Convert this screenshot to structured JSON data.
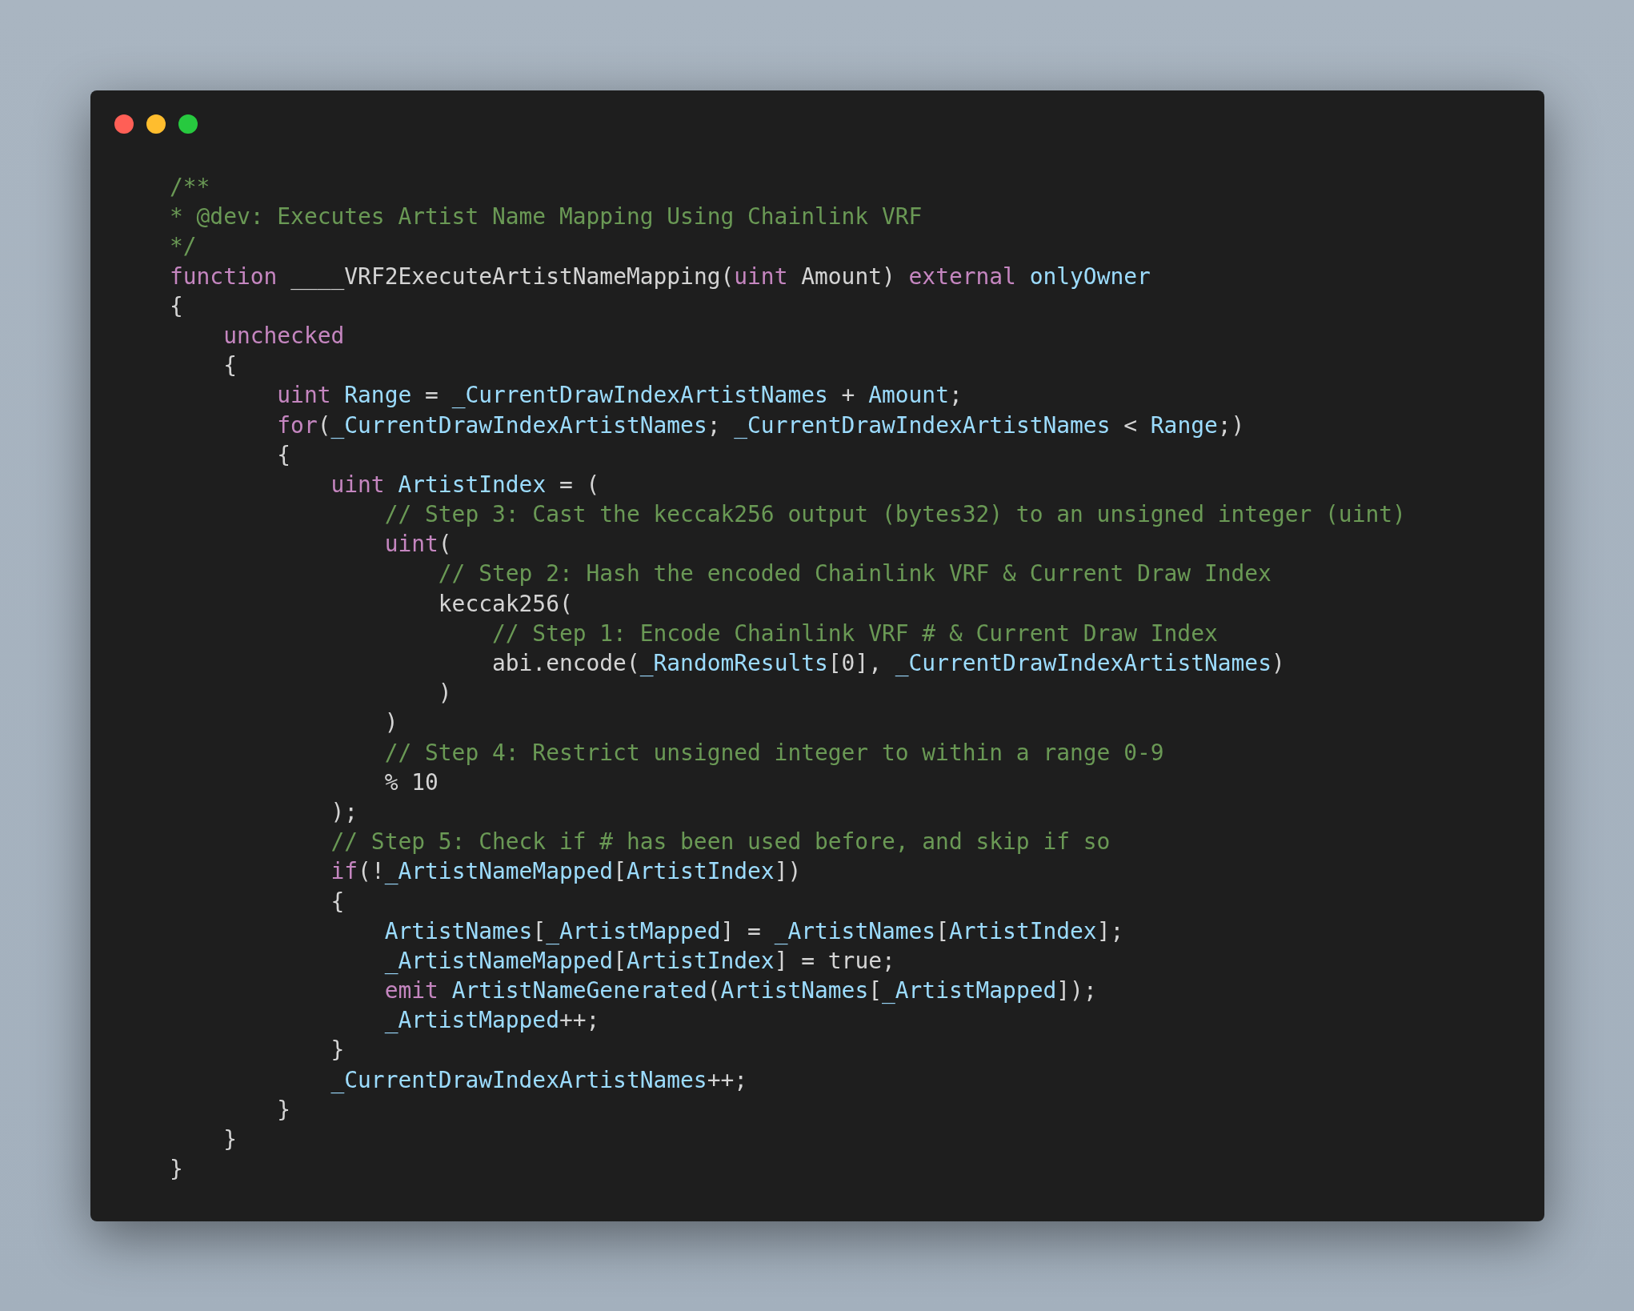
{
  "window": {
    "controls": [
      {
        "kind": "close"
      },
      {
        "kind": "minimize"
      },
      {
        "kind": "zoom"
      }
    ]
  },
  "code_lines": [
    [
      {
        "kind": "comment",
        "text": "/**"
      }
    ],
    [
      {
        "kind": "comment",
        "text": "* @dev: Executes Artist Name Mapping Using Chainlink VRF"
      }
    ],
    [
      {
        "kind": "comment",
        "text": "*/"
      }
    ],
    [
      {
        "kind": "keyword",
        "text": "function"
      },
      {
        "kind": "plain",
        "text": " ____VRF2ExecuteArtistNameMapping("
      },
      {
        "kind": "keyword",
        "text": "uint"
      },
      {
        "kind": "plain",
        "text": " Amount) "
      },
      {
        "kind": "keyword",
        "text": "external"
      },
      {
        "kind": "variable",
        "text": " onlyOwner"
      }
    ],
    [
      {
        "kind": "plain",
        "text": "{"
      }
    ],
    [
      {
        "kind": "keyword",
        "text": "    unchecked"
      }
    ],
    [
      {
        "kind": "plain",
        "text": "    {"
      }
    ],
    [
      {
        "kind": "keyword",
        "text": "        uint"
      },
      {
        "kind": "variable",
        "text": " Range"
      },
      {
        "kind": "plain",
        "text": " = "
      },
      {
        "kind": "variable",
        "text": "_CurrentDrawIndexArtistNames"
      },
      {
        "kind": "plain",
        "text": " + "
      },
      {
        "kind": "variable",
        "text": "Amount"
      },
      {
        "kind": "plain",
        "text": ";"
      }
    ],
    [
      {
        "kind": "keyword",
        "text": "        for"
      },
      {
        "kind": "plain",
        "text": "("
      },
      {
        "kind": "variable",
        "text": "_CurrentDrawIndexArtistNames"
      },
      {
        "kind": "plain",
        "text": "; "
      },
      {
        "kind": "variable",
        "text": "_CurrentDrawIndexArtistNames"
      },
      {
        "kind": "plain",
        "text": " < "
      },
      {
        "kind": "variable",
        "text": "Range"
      },
      {
        "kind": "plain",
        "text": ";)"
      }
    ],
    [
      {
        "kind": "plain",
        "text": "        {"
      }
    ],
    [
      {
        "kind": "keyword",
        "text": "            uint"
      },
      {
        "kind": "variable",
        "text": " ArtistIndex"
      },
      {
        "kind": "plain",
        "text": " = ("
      }
    ],
    [
      {
        "kind": "comment",
        "text": "                // Step 3: Cast the keccak256 output (bytes32) to an unsigned integer (uint)"
      }
    ],
    [
      {
        "kind": "keyword",
        "text": "                uint"
      },
      {
        "kind": "plain",
        "text": "("
      }
    ],
    [
      {
        "kind": "comment",
        "text": "                    // Step 2: Hash the encoded Chainlink VRF & Current Draw Index"
      }
    ],
    [
      {
        "kind": "plain",
        "text": "                    keccak256("
      }
    ],
    [
      {
        "kind": "comment",
        "text": "                        // Step 1: Encode Chainlink VRF # & Current Draw Index"
      }
    ],
    [
      {
        "kind": "plain",
        "text": "                        abi.encode("
      },
      {
        "kind": "variable",
        "text": "_RandomResults"
      },
      {
        "kind": "plain",
        "text": "[0], "
      },
      {
        "kind": "variable",
        "text": "_CurrentDrawIndexArtistNames"
      },
      {
        "kind": "plain",
        "text": ")"
      }
    ],
    [
      {
        "kind": "plain",
        "text": "                    )"
      }
    ],
    [
      {
        "kind": "plain",
        "text": "                )"
      }
    ],
    [
      {
        "kind": "comment",
        "text": "                // Step 4: Restrict unsigned integer to within a range 0-9"
      }
    ],
    [
      {
        "kind": "plain",
        "text": "                % 10"
      }
    ],
    [
      {
        "kind": "plain",
        "text": "            );"
      }
    ],
    [
      {
        "kind": "comment",
        "text": "            // Step 5: Check if # has been used before, and skip if so"
      }
    ],
    [
      {
        "kind": "keyword",
        "text": "            if"
      },
      {
        "kind": "plain",
        "text": "(!"
      },
      {
        "kind": "variable",
        "text": "_ArtistNameMapped"
      },
      {
        "kind": "plain",
        "text": "["
      },
      {
        "kind": "variable",
        "text": "ArtistIndex"
      },
      {
        "kind": "plain",
        "text": "])"
      }
    ],
    [
      {
        "kind": "plain",
        "text": "            {"
      }
    ],
    [
      {
        "kind": "variable",
        "text": "                ArtistNames"
      },
      {
        "kind": "plain",
        "text": "["
      },
      {
        "kind": "variable",
        "text": "_ArtistMapped"
      },
      {
        "kind": "plain",
        "text": "] = "
      },
      {
        "kind": "variable",
        "text": "_ArtistNames"
      },
      {
        "kind": "plain",
        "text": "["
      },
      {
        "kind": "variable",
        "text": "ArtistIndex"
      },
      {
        "kind": "plain",
        "text": "];"
      }
    ],
    [
      {
        "kind": "variable",
        "text": "                _ArtistNameMapped"
      },
      {
        "kind": "plain",
        "text": "["
      },
      {
        "kind": "variable",
        "text": "ArtistIndex"
      },
      {
        "kind": "plain",
        "text": "] = true;"
      }
    ],
    [
      {
        "kind": "keyword",
        "text": "                emit"
      },
      {
        "kind": "variable",
        "text": " ArtistNameGenerated"
      },
      {
        "kind": "plain",
        "text": "("
      },
      {
        "kind": "variable",
        "text": "ArtistNames"
      },
      {
        "kind": "plain",
        "text": "["
      },
      {
        "kind": "variable",
        "text": "_ArtistMapped"
      },
      {
        "kind": "plain",
        "text": "]);"
      }
    ],
    [
      {
        "kind": "variable",
        "text": "                _ArtistMapped"
      },
      {
        "kind": "plain",
        "text": "++;"
      }
    ],
    [
      {
        "kind": "plain",
        "text": "            }"
      }
    ],
    [
      {
        "kind": "variable",
        "text": "            _CurrentDrawIndexArtistNames"
      },
      {
        "kind": "plain",
        "text": "++;"
      }
    ],
    [
      {
        "kind": "plain",
        "text": "        }"
      }
    ],
    [
      {
        "kind": "plain",
        "text": "    }"
      }
    ],
    [
      {
        "kind": "plain",
        "text": "}"
      }
    ]
  ]
}
